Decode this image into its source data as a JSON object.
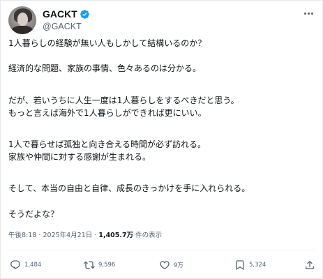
{
  "post": {
    "author": {
      "display_name": "GACKT",
      "handle": "@GACKT",
      "verified": true
    },
    "lines": [
      "1人暮らしの経験が無い人もしかして結構いるのか？",
      "経済的な問題、家族の事情、色々あるのは分かる。",
      "だが、若いうちに人生一度は1人暮らしをするべきだと思う。",
      "もっと言えば海外で1人暮らしができれば更にいい。",
      "1人で暮らせば孤独と向き合える時間が必ず訪れる。",
      "家族や仲間に対する感謝が生まれる。",
      "そして、本当の自由と自律、成長のきっかけを手に入れられる。",
      "そうだよな？"
    ],
    "meta": {
      "time": "午後8:18",
      "separator": "·",
      "date": "2025年4月21日",
      "views_count": "1,405.7万",
      "views_label": "件の表示"
    },
    "actions": {
      "replies": "1,484",
      "reposts": "9,596",
      "likes": "9万",
      "bookmarks": "5,324"
    }
  },
  "icons": {
    "verified": "verified-badge-icon",
    "more": "more-horizontal-icon",
    "reply": "reply-bubble-icon",
    "repost": "repost-arrows-icon",
    "like": "heart-icon",
    "bookmark": "bookmark-icon",
    "share": "share-upload-icon"
  },
  "colors": {
    "text": "#0f1419",
    "secondary": "#536471",
    "verified": "#1d9bf0",
    "divider": "#eff3f4"
  }
}
